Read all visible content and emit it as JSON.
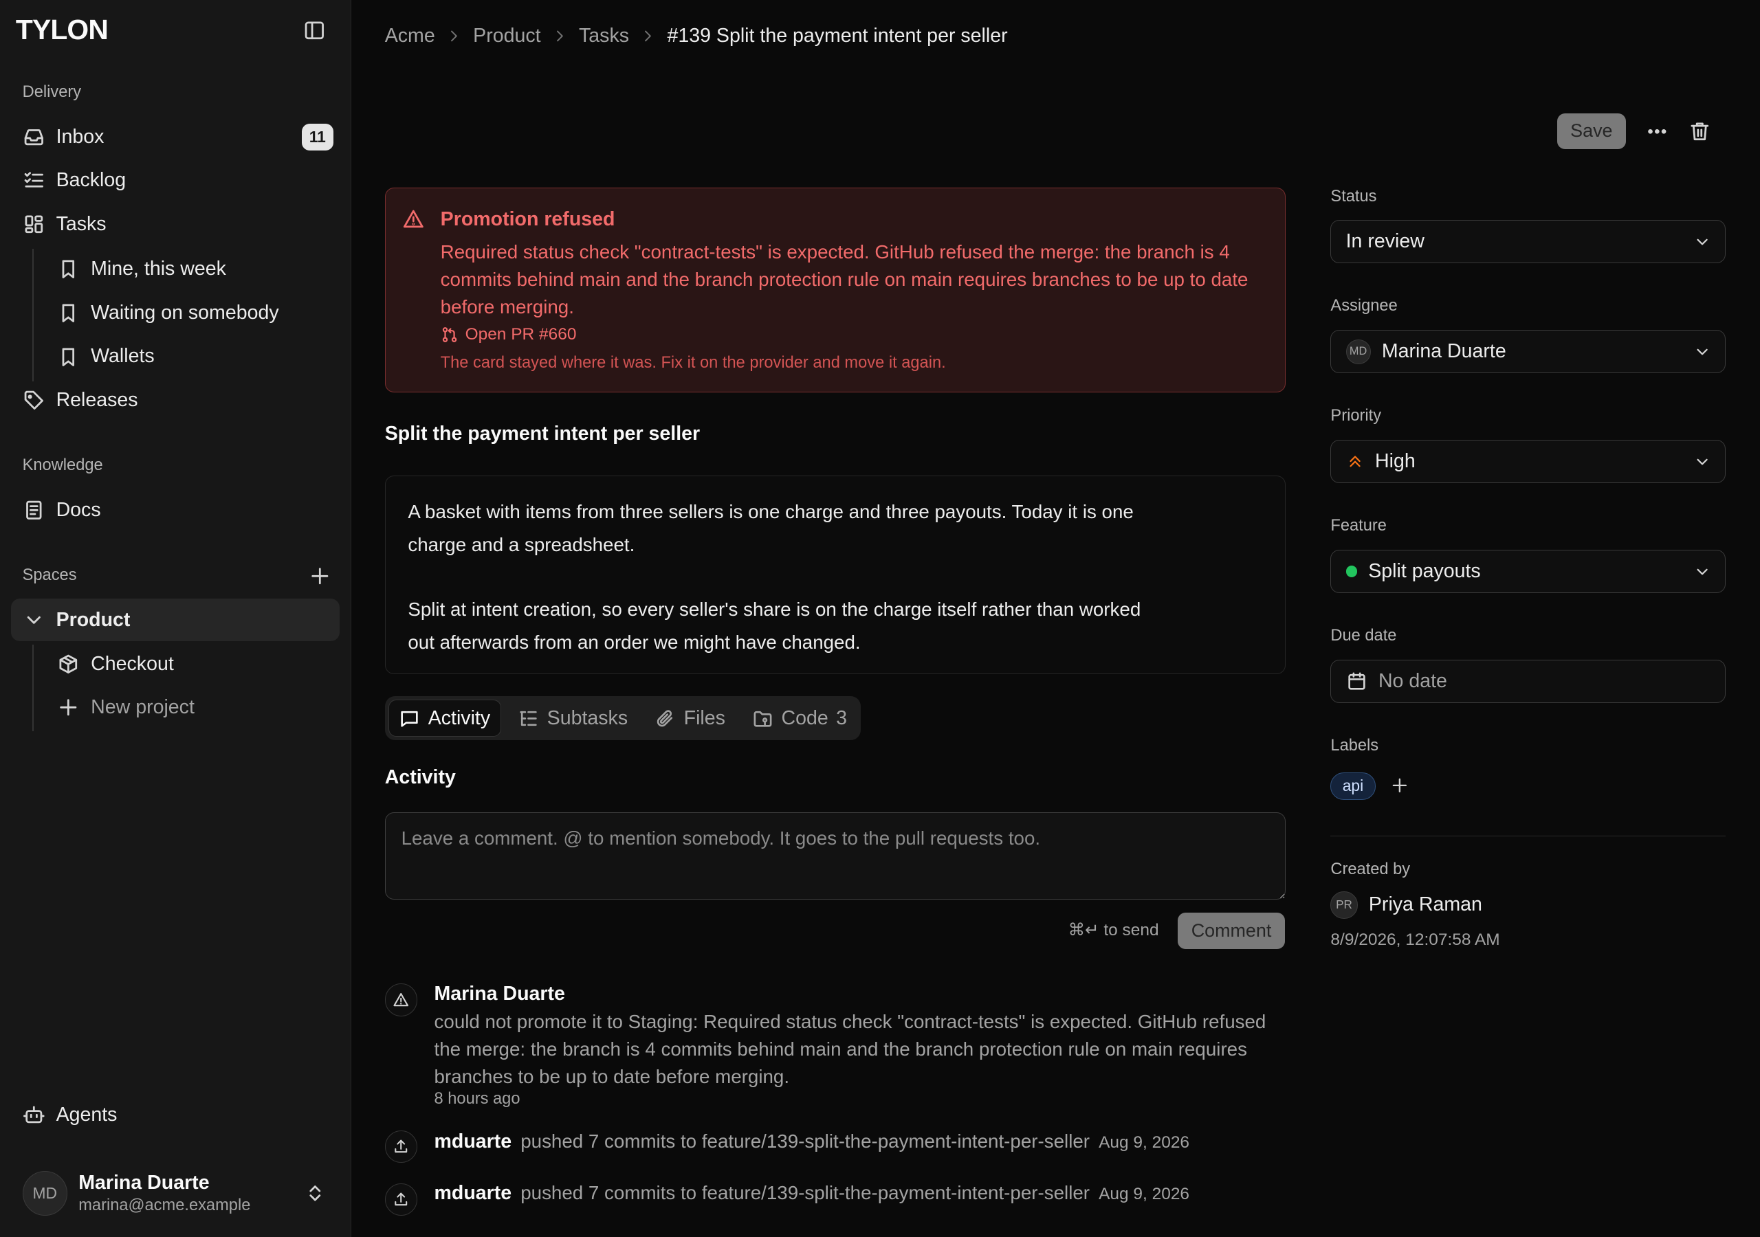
{
  "app": {
    "logo": "TYLON"
  },
  "sidebar": {
    "delivery_label": "Delivery",
    "inbox": {
      "label": "Inbox",
      "count": "11"
    },
    "backlog": "Backlog",
    "tasks": "Tasks",
    "views": [
      "Mine, this week",
      "Waiting on somebody",
      "Wallets"
    ],
    "releases": "Releases",
    "knowledge_label": "Knowledge",
    "docs": "Docs",
    "spaces_label": "Spaces",
    "space": "Product",
    "projects": [
      "Checkout"
    ],
    "new_project": "New project",
    "agents": "Agents",
    "user": {
      "initials": "MD",
      "name": "Marina Duarte",
      "email": "marina@acme.example"
    }
  },
  "breadcrumb": [
    "Acme",
    "Product",
    "Tasks",
    "#139 Split the payment intent per seller"
  ],
  "toolbar": {
    "save": "Save"
  },
  "alert": {
    "title": "Promotion refused",
    "body": "Required status check \"contract-tests\" is expected. GitHub refused the merge: the branch is 4 commits behind main and the branch protection rule on main requires branches to be up to date before merging.",
    "link": "Open PR #660",
    "note": "The card stayed where it was. Fix it on the provider and move it again."
  },
  "task": {
    "title": "Split the payment intent per seller",
    "description": [
      "A basket with items from three sellers is one charge and three payouts. Today it is one charge and a spreadsheet.",
      "Split at intent creation, so every seller's share is on the charge itself rather than worked out afterwards from an order we might have changed."
    ]
  },
  "tabs": {
    "activity": "Activity",
    "subtasks": "Subtasks",
    "files": "Files",
    "code": "Code",
    "code_count": "3"
  },
  "activity": {
    "heading": "Activity",
    "comment_placeholder": "Leave a comment. @ to mention somebody. It goes to the pull requests too.",
    "send_hint": "⌘↵ to send",
    "comment_button": "Comment",
    "events": [
      {
        "author": "Marina Duarte",
        "text": "could not promote it to Staging: Required status check \"contract-tests\" is expected. GitHub refused the merge: the branch is 4 commits behind main and the branch protection rule on main requires branches to be up to date before merging.",
        "time": "8 hours ago"
      }
    ],
    "pushes": [
      {
        "user": "mduarte",
        "text": "pushed 7 commits to feature/139-split-the-payment-intent-per-seller",
        "date": "Aug 9, 2026"
      },
      {
        "user": "mduarte",
        "text": "pushed 7 commits to feature/139-split-the-payment-intent-per-seller",
        "date": "Aug 9, 2026"
      }
    ]
  },
  "details": {
    "status_label": "Status",
    "status": "In review",
    "assignee_label": "Assignee",
    "assignee": {
      "initials": "MD",
      "name": "Marina Duarte"
    },
    "priority_label": "Priority",
    "priority": "High",
    "priority_color": "#f97316",
    "feature_label": "Feature",
    "feature": "Split payouts",
    "feature_color": "#22c55e",
    "due_label": "Due date",
    "due": "No date",
    "labels_label": "Labels",
    "labels": [
      "api"
    ],
    "created_label": "Created by",
    "creator": {
      "initials": "PR",
      "name": "Priya Raman"
    },
    "created_at": "8/9/2026, 12:07:58 AM"
  }
}
